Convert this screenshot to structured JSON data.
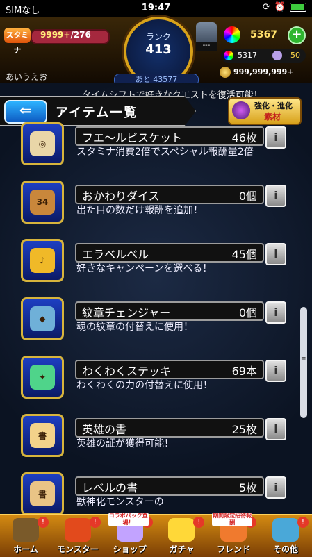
{
  "status_bar": {
    "carrier": "SIMなし",
    "time": "19:47"
  },
  "hud": {
    "stamina_label": "スタミナ",
    "stamina_current": "9999+",
    "stamina_max": "/276",
    "rank_label": "ランク",
    "rank_value": "413",
    "next_rank": "あと 43577",
    "box_tag": "---",
    "orbs": "5367",
    "sub_orbs": "5317",
    "sub_gems": "50",
    "coins": "999,999,999+"
  },
  "main": {
    "tab_label": "あいうえお",
    "background_text": "タイムシフトで好きなクエストを復活可能！",
    "title": "アイテム一覧",
    "enhance_button": {
      "line1": "強化・進化",
      "line2": "素材"
    },
    "items": [
      {
        "name": "フエ～ルビスケット",
        "qty": "46枚",
        "desc": "スタミナ消費2倍でスペシャル報酬量2倍",
        "color": "#e9d6a8",
        "glyph": "◎"
      },
      {
        "name": "おかわりダイス",
        "qty": "0個",
        "desc": "出た目の数だけ報酬を追加！",
        "color": "#c9873b",
        "glyph": "34"
      },
      {
        "name": "エラベルベル",
        "qty": "45個",
        "desc": "好きなキャンペーンを選べる！",
        "color": "#f0b928",
        "glyph": "♪"
      },
      {
        "name": "紋章チェンジャー",
        "qty": "0個",
        "desc": "魂の紋章の付替えに使用！",
        "color": "#6fb0d8",
        "glyph": "◆"
      },
      {
        "name": "わくわくステッキ",
        "qty": "69本",
        "desc": "わくわくの力の付替えに使用！",
        "color": "#4fd48a",
        "glyph": "✦"
      },
      {
        "name": "英雄の書",
        "qty": "25枚",
        "desc": "英雄の証が獲得可能！",
        "color": "#f3d28a",
        "glyph": "書"
      },
      {
        "name": "レベルの書",
        "qty": "5枚",
        "desc": "獣神化モンスターの",
        "color": "#e9c486",
        "glyph": "書"
      }
    ]
  },
  "nav": {
    "items": [
      {
        "label": "ホーム",
        "color": "#7a5a2a"
      },
      {
        "label": "モンスター",
        "color": "#e24a1c"
      },
      {
        "label": "ショップ",
        "color": "#c2a3ff",
        "tag": "コラボパック登場！"
      },
      {
        "label": "ガチャ",
        "color": "#ffd838"
      },
      {
        "label": "フレンド",
        "color": "#f07a2e",
        "tag": "期間限定招待報酬"
      },
      {
        "label": "その他",
        "color": "#4aa8d8"
      }
    ],
    "badge": "!"
  }
}
